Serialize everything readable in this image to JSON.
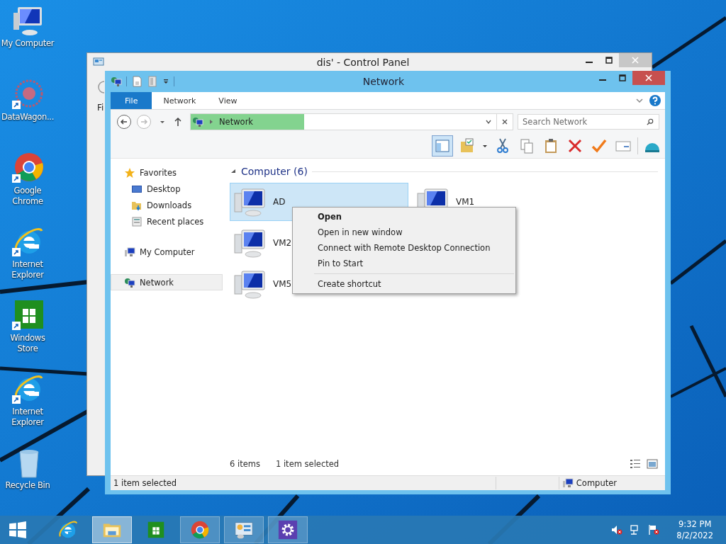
{
  "desktop_icons": [
    {
      "label": "My Computer",
      "kind": "computer",
      "shortcut": false
    },
    {
      "label": "DataWagon...",
      "kind": "app",
      "shortcut": true
    },
    {
      "label": "Google Chrome",
      "kind": "chrome",
      "shortcut": true
    },
    {
      "label": "Internet Explorer",
      "kind": "ie",
      "shortcut": true
    },
    {
      "label": "Windows Store",
      "kind": "store",
      "shortcut": true
    },
    {
      "label": "Internet Explorer",
      "kind": "ie",
      "shortcut": true
    },
    {
      "label": "Recycle Bin",
      "kind": "bin",
      "shortcut": false
    }
  ],
  "back_window": {
    "title": "dis' - Control Panel",
    "menu_fragment": "Fi"
  },
  "window": {
    "title": "Network",
    "ribbon_tabs": [
      {
        "label": "File",
        "selected": true
      },
      {
        "label": "Network",
        "selected": false
      },
      {
        "label": "View",
        "selected": false
      }
    ],
    "address": "Network",
    "search": {
      "placeholder": "Search Network"
    }
  },
  "nav": [
    {
      "label": "Favorites",
      "kind": "star",
      "selected": false,
      "children": [
        {
          "label": "Desktop",
          "kind": "desktop",
          "selected": false
        },
        {
          "label": "Downloads",
          "kind": "downloads",
          "selected": false
        },
        {
          "label": "Recent places",
          "kind": "recent",
          "selected": false
        }
      ]
    },
    {
      "label": "My Computer",
      "kind": "computer",
      "selected": false
    },
    {
      "label": "Network",
      "kind": "network",
      "selected": true
    }
  ],
  "group": {
    "title": "Computer (6)"
  },
  "items": [
    {
      "label": "AD",
      "selected": true
    },
    {
      "label": "VM1",
      "selected": false
    },
    {
      "label": "VM2",
      "selected": false
    },
    {
      "label": "VM5",
      "selected": false
    }
  ],
  "context_menu": [
    {
      "label": "Open",
      "kind": "item",
      "default": true
    },
    {
      "label": "Open in new window",
      "kind": "item",
      "default": false
    },
    {
      "label": "Connect with Remote Desktop Connection",
      "kind": "item",
      "default": false
    },
    {
      "label": "Pin to Start",
      "kind": "item",
      "default": false
    },
    {
      "kind": "separator"
    },
    {
      "label": "Create shortcut",
      "kind": "item",
      "default": false
    }
  ],
  "content_status": {
    "count": "6 items",
    "selection": "1 item selected"
  },
  "status_bar": {
    "text": "1 item selected",
    "zone": "Computer"
  },
  "taskbar": {
    "apps": [
      {
        "kind": "ie",
        "running": false,
        "selected": false
      },
      {
        "kind": "explorer",
        "running": true,
        "selected": true
      },
      {
        "kind": "store",
        "running": false,
        "selected": false
      },
      {
        "kind": "chrome",
        "running": true,
        "selected": false
      },
      {
        "kind": "controlpanel",
        "running": true,
        "selected": false
      },
      {
        "kind": "settings",
        "running": true,
        "selected": false
      }
    ],
    "clock": {
      "time": "9:32 PM",
      "date": "8/2/2022"
    }
  }
}
